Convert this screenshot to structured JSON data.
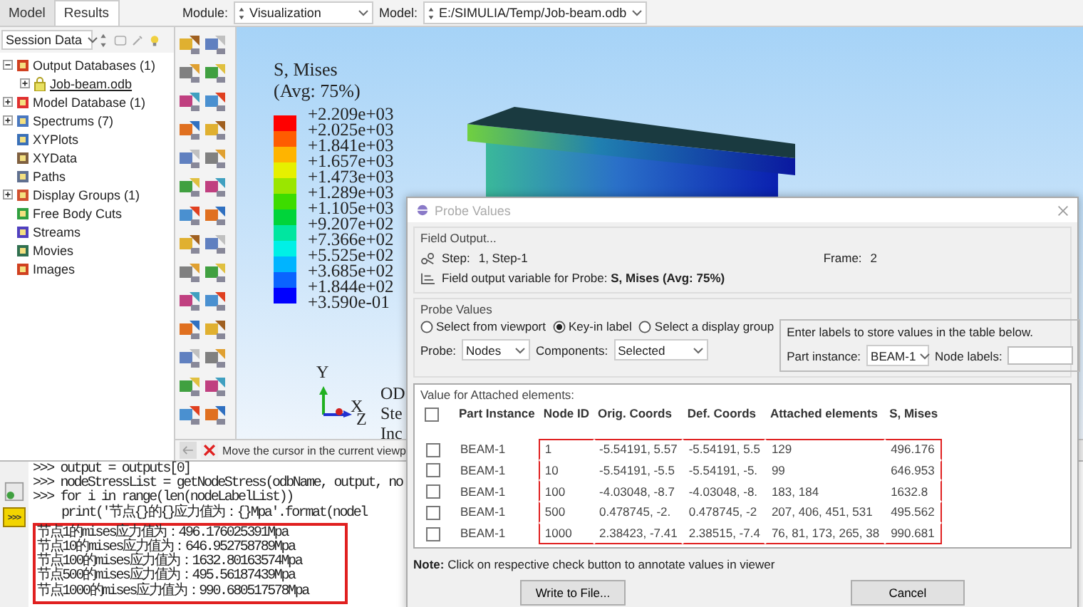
{
  "tabs": [
    {
      "label": "Model",
      "selected": false
    },
    {
      "label": "Results",
      "selected": true
    }
  ],
  "context_bar": {
    "module_label": "Module:",
    "module": "Visualization",
    "model_label": "Model:",
    "model": "E:/SIMULIA/Temp/Job-beam.odb"
  },
  "session": {
    "value": "Session Data"
  },
  "tree": [
    {
      "label": "Output Databases (1)",
      "expanded": true,
      "children": [
        {
          "label": "Job-beam.odb",
          "expanded": false
        }
      ]
    },
    {
      "label": "Model Database (1)",
      "expanded": false
    },
    {
      "label": "Spectrums (7)",
      "expanded": false
    },
    {
      "label": "XYPlots"
    },
    {
      "label": "XYData"
    },
    {
      "label": "Paths"
    },
    {
      "label": "Display Groups (1)",
      "expanded": false
    },
    {
      "label": "Free Body Cuts"
    },
    {
      "label": "Streams"
    },
    {
      "label": "Movies"
    },
    {
      "label": "Images"
    }
  ],
  "legend": {
    "title": "S, Mises",
    "subtitle": "(Avg: 75%)",
    "bands": [
      {
        "color": "#ff0000"
      },
      {
        "color": "#ff5c00"
      },
      {
        "color": "#ffb400"
      },
      {
        "color": "#e6f000"
      },
      {
        "color": "#9ae600"
      },
      {
        "color": "#3ddc00"
      },
      {
        "color": "#00d43a"
      },
      {
        "color": "#00e6a0"
      },
      {
        "color": "#00f0e6"
      },
      {
        "color": "#00b4ff"
      },
      {
        "color": "#0a64ff"
      },
      {
        "color": "#0000ff"
      }
    ],
    "labels": [
      "+2.209e+03",
      "+2.025e+03",
      "+1.841e+03",
      "+1.657e+03",
      "+1.473e+03",
      "+1.289e+03",
      "+1.105e+03",
      "+9.207e+02",
      "+7.366e+02",
      "+5.525e+02",
      "+3.685e+02",
      "+1.844e+02",
      "+3.590e-01"
    ]
  },
  "triad": {
    "y": "Y",
    "x": "X",
    "z": "Z"
  },
  "info_lines": [
    "OD",
    "Ste",
    "Inc"
  ],
  "prompt": {
    "text": "Move the cursor in the current viewp"
  },
  "console": {
    "mode_button": ">>>",
    "lines": [
      {
        "kind": "input",
        "text": ">>> output = outputs[0]"
      },
      {
        "kind": "input",
        "text": ">>> nodeStressList = getNodeStress(odbName, output, no"
      },
      {
        "kind": "input",
        "text": ">>> for i in range(len(nodeLabelList))"
      },
      {
        "kind": "continuation",
        "text": "print('节点{}的{}应力值为：{}Mpa'.format(nodel"
      }
    ],
    "results": [
      "节点1的mises应力值为：496.176025391Mpa",
      "节点10的mises应力值为：646.952758789Mpa",
      "节点100的mises应力值为：1632.80163574Mpa",
      "节点500的mises应力值为：495.56187439Mpa",
      "节点1000的mises应力值为：990.680517578Mpa"
    ]
  },
  "dialog": {
    "title": "Probe Values",
    "field_output": {
      "title": "Field Output...",
      "step_label": "Step:",
      "step": "1, Step-1",
      "frame_label": "Frame:",
      "frame": "2",
      "variable": "Field output variable for Probe: **S, Mises (Avg: 75%)**"
    },
    "probe_values": {
      "title": "Probe Values",
      "radios": [
        {
          "label": "Select from viewport",
          "selected": false
        },
        {
          "label": "Key-in label",
          "selected": true
        },
        {
          "label": "Select a display group",
          "selected": false
        }
      ],
      "probe_label": "Probe:",
      "probe": "Nodes",
      "components_label": "Components:",
      "components": "Selected",
      "hint": "Enter labels to store values in the table below.",
      "part_label": "Part instance:",
      "part": "BEAM-1",
      "node_labels_label": "Node labels:"
    },
    "table": {
      "title": "Value for Attached elements:",
      "header_checked": false,
      "columns": [
        "Part Instance",
        "Node ID",
        "Orig. Coords",
        "Def. Coords",
        "Attached elements",
        "S, Mises"
      ],
      "rows": [
        {
          "checked": false,
          "cells": [
            "BEAM-1",
            "1",
            "-5.54191, 5.57",
            "-5.54191, 5.5",
            "129",
            "496.176"
          ]
        },
        {
          "checked": false,
          "cells": [
            "BEAM-1",
            "10",
            "-5.54191, -5.5",
            "-5.54191, -5.",
            "99",
            "646.953"
          ]
        },
        {
          "checked": false,
          "cells": [
            "BEAM-1",
            "100",
            "-4.03048, -8.7",
            "-4.03048, -8.",
            "183, 184",
            "1632.8"
          ]
        },
        {
          "checked": false,
          "cells": [
            "BEAM-1",
            "500",
            "0.478745, -2.",
            "0.478745, -2",
            "207, 406, 451, 531",
            "495.562"
          ]
        },
        {
          "checked": false,
          "cells": [
            "BEAM-1",
            "1000",
            "2.38423, -7.41",
            "2.38515, -7.4",
            "76, 81, 173, 265, 38",
            "990.681"
          ]
        }
      ]
    },
    "note": "**Note:**  Click on respective check button to annotate values in viewer",
    "buttons": [
      "Write to File...",
      "Cancel"
    ]
  }
}
